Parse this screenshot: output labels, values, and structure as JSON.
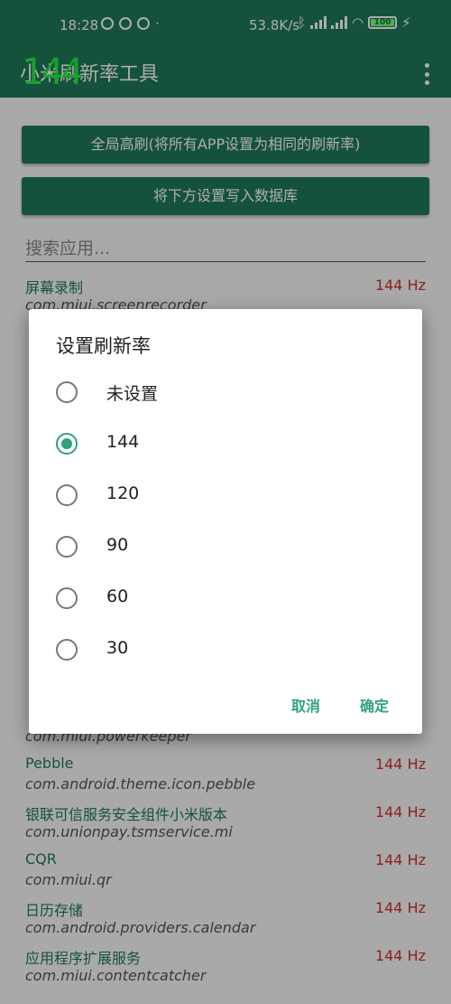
{
  "status_bar": {
    "time": "18:28",
    "net_speed": "53.8K/s",
    "battery": "100",
    "icons": [
      "cloud-icon",
      "notification-icon",
      "circle-100-icon",
      "dot-icon",
      "bluetooth-icon",
      "signal-icon",
      "signal-icon",
      "wifi-icon",
      "battery-icon",
      "charging-icon"
    ]
  },
  "app_bar": {
    "title": "小米刷新率工具",
    "overlay_rate": "144",
    "menu_icon": "more-vert-icon"
  },
  "buttons": {
    "global": "全局高刷(将所有APP设置为相同的刷新率)",
    "write_db": "将下方设置写入数据库"
  },
  "search": {
    "placeholder": "搜索应用..."
  },
  "apps": [
    {
      "name": "屏幕录制",
      "package": "com.miui.screenrecorder",
      "rate": "144 Hz"
    },
    {
      "name": "",
      "package": "",
      "rate": ""
    },
    {
      "name": "",
      "package": "",
      "rate": ""
    },
    {
      "name": "",
      "package": "",
      "rate": ""
    },
    {
      "name": "",
      "package": "",
      "rate": ""
    },
    {
      "name": "",
      "package": "",
      "rate": ""
    },
    {
      "name": "",
      "package": "",
      "rate": ""
    },
    {
      "name": "",
      "package": "",
      "rate": ""
    },
    {
      "name": "",
      "package": "",
      "rate": ""
    },
    {
      "name": "",
      "package": "com.miui.powerkeeper",
      "rate": ""
    },
    {
      "name": "Pebble",
      "package": "com.android.theme.icon.pebble",
      "rate": "144 Hz"
    },
    {
      "name": "银联可信服务安全组件小米版本",
      "package": "com.unionpay.tsmservice.mi",
      "rate": "144 Hz"
    },
    {
      "name": "CQR",
      "package": "com.miui.qr",
      "rate": "144 Hz"
    },
    {
      "name": "日历存储",
      "package": "com.android.providers.calendar",
      "rate": "144 Hz"
    },
    {
      "name": "应用程序扩展服务",
      "package": "com.miui.contentcatcher",
      "rate": "144 Hz"
    }
  ],
  "dialog": {
    "title": "设置刷新率",
    "options": [
      {
        "label": "未设置",
        "checked": false
      },
      {
        "label": "144",
        "checked": true
      },
      {
        "label": "120",
        "checked": false
      },
      {
        "label": "90",
        "checked": false
      },
      {
        "label": "60",
        "checked": false
      },
      {
        "label": "30",
        "checked": false
      }
    ],
    "cancel": "取消",
    "confirm": "确定"
  },
  "colors": {
    "primary": "#1f7a57",
    "accent": "#2fa37a",
    "rate_text": "#d32f2f",
    "overlay": "#22ee44"
  }
}
